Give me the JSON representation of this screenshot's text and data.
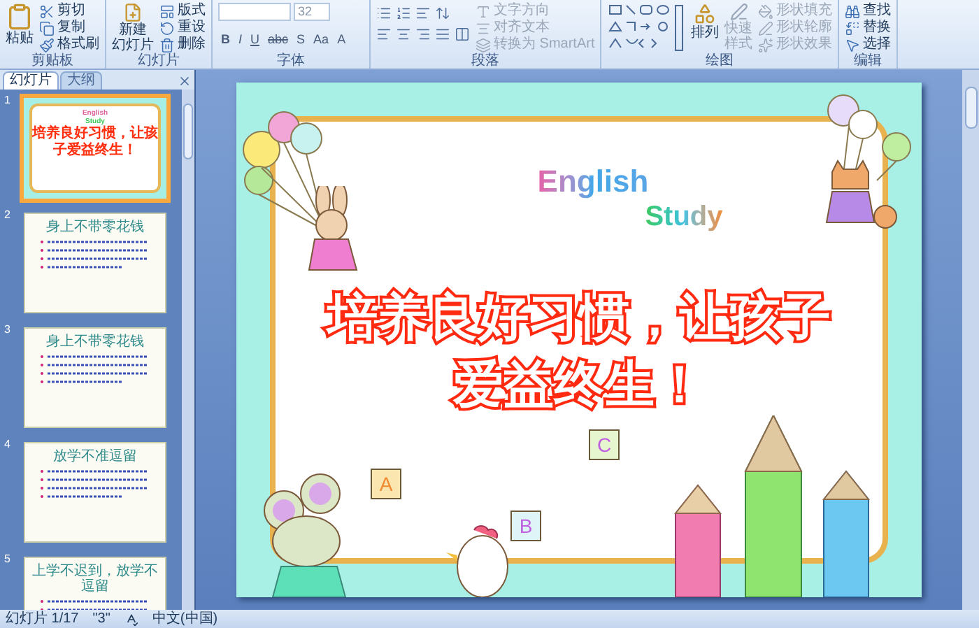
{
  "ribbon": {
    "clipboard": {
      "label": "剪贴板",
      "paste": "粘贴",
      "items": [
        "剪切",
        "复制",
        "格式刷"
      ]
    },
    "slides": {
      "label": "幻灯片",
      "new_slide": [
        "新建",
        "幻灯片"
      ],
      "items": [
        "版式",
        "重设",
        "删除"
      ]
    },
    "font": {
      "label": "字体",
      "size": "32",
      "format_buttons": [
        "B",
        "I",
        "U",
        "abc",
        "S",
        "Aa",
        "A"
      ]
    },
    "paragraph": {
      "label": "段落",
      "items": [
        "文字方向",
        "对齐文本",
        "转换为 SmartArt"
      ]
    },
    "drawing": {
      "label": "绘图",
      "arrange": "排列",
      "quick_styles": [
        "快速",
        "样式"
      ],
      "items": [
        {
          "label": "形状填充",
          "disabled": true
        },
        {
          "label": "形状轮廓",
          "disabled": true
        },
        {
          "label": "形状效果",
          "disabled": true
        }
      ]
    },
    "editing": {
      "label": "编辑",
      "items": [
        "查找",
        "替换",
        "选择"
      ]
    }
  },
  "pane_tabs": [
    {
      "label": "幻灯片",
      "selected": true
    },
    {
      "label": "大纲",
      "selected": false
    }
  ],
  "thumbnails": [
    {
      "number": "1",
      "kind": "cover",
      "selected": true,
      "english": "English",
      "study": "Study",
      "title": "培养良好习惯，让孩子爱益终生！"
    },
    {
      "number": "2",
      "kind": "list",
      "selected": false,
      "title": "身上不带零花钱"
    },
    {
      "number": "3",
      "kind": "list",
      "selected": false,
      "title": "身上不带零花钱"
    },
    {
      "number": "4",
      "kind": "list",
      "selected": false,
      "title": "放学不准逗留"
    },
    {
      "number": "5",
      "kind": "list",
      "selected": false,
      "title": "上学不迟到，放学不逗留"
    }
  ],
  "slide": {
    "english": "English",
    "study": "Study",
    "title_lines": [
      "培养良好习惯，让孩子",
      "爱益终生！"
    ],
    "cards": [
      "A",
      "B",
      "C"
    ]
  },
  "status_bar": {
    "slide": "幻灯片 1/17",
    "theme": "\"3\"",
    "language": "中文(中国)"
  }
}
